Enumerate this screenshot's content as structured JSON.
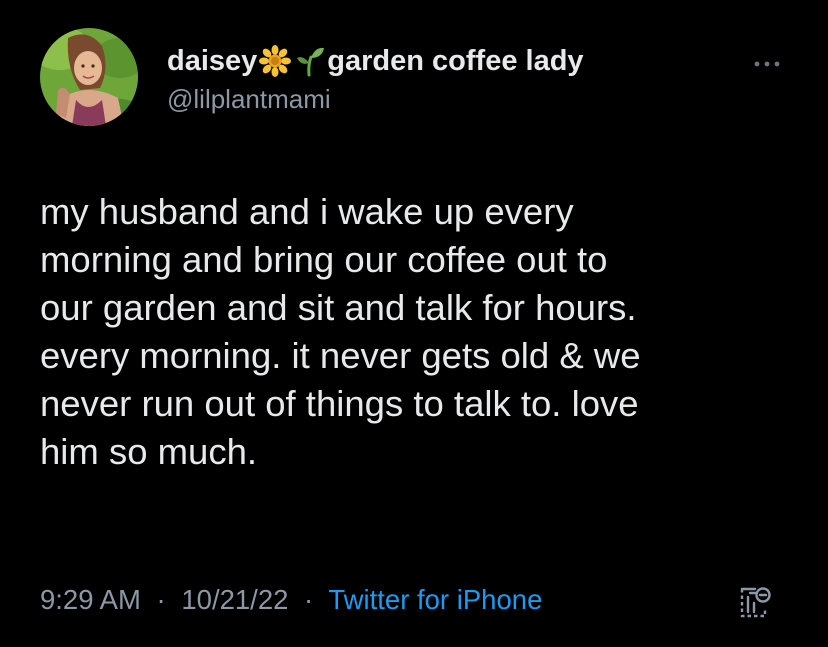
{
  "author": {
    "display_name_part1": "daisey",
    "display_name_part2": "garden coffee lady",
    "handle": "@lilplantmami",
    "name_emojis": [
      "sunflower-icon",
      "seedling-icon"
    ]
  },
  "tweet": {
    "text_lines": [
      "my husband and i wake up every",
      "morning and bring our coffee out to",
      "our garden and sit and talk for hours.",
      "every morning. it never gets old & we",
      "never run out of things to talk to. love",
      "him so much."
    ]
  },
  "meta": {
    "time": "9:29 AM",
    "separator": "·",
    "date": "10/21/22",
    "source": "Twitter for iPhone"
  },
  "icons": {
    "more": "more-options-icon",
    "analytics": "tweet-analytics-icon"
  },
  "colors": {
    "background": "#000000",
    "primary_text": "#e7e9ea",
    "secondary_text": "#8b98a5",
    "link": "#1d9bf0"
  }
}
